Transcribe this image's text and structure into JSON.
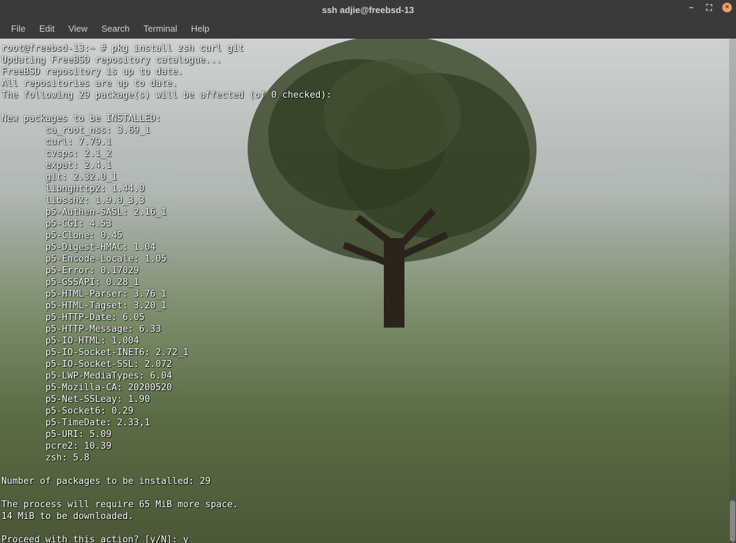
{
  "window": {
    "title": "ssh adjie@freebsd-13",
    "controls": {
      "minimize": "−",
      "maximize": "⛶",
      "close": "×"
    }
  },
  "menu": {
    "items": [
      "File",
      "Edit",
      "View",
      "Search",
      "Terminal",
      "Help"
    ]
  },
  "terminal": {
    "prompt": "root@freebsd-13:~ # ",
    "command": "pkg install zsh curl git",
    "preamble": [
      "Updating FreeBSD repository catalogue...",
      "FreeBSD repository is up to date.",
      "All repositories are up to date.",
      "The following 29 package(s) will be affected (of 0 checked):",
      "",
      "New packages to be INSTALLED:"
    ],
    "packages": [
      {
        "name": "ca_root_nss",
        "version": "3.69_1"
      },
      {
        "name": "curl",
        "version": "7.79.1"
      },
      {
        "name": "cvsps",
        "version": "2.1_2"
      },
      {
        "name": "expat",
        "version": "2.4.1"
      },
      {
        "name": "git",
        "version": "2.32.0_1"
      },
      {
        "name": "libnghttp2",
        "version": "1.44.0"
      },
      {
        "name": "libssh2",
        "version": "1.9.0_3,3"
      },
      {
        "name": "p5-Authen-SASL",
        "version": "2.16_1"
      },
      {
        "name": "p5-CGI",
        "version": "4.53"
      },
      {
        "name": "p5-Clone",
        "version": "0.45"
      },
      {
        "name": "p5-Digest-HMAC",
        "version": "1.04"
      },
      {
        "name": "p5-Encode-Locale",
        "version": "1.05"
      },
      {
        "name": "p5-Error",
        "version": "0.17029"
      },
      {
        "name": "p5-GSSAPI",
        "version": "0.28_1"
      },
      {
        "name": "p5-HTML-Parser",
        "version": "3.76_1"
      },
      {
        "name": "p5-HTML-Tagset",
        "version": "3.20_1"
      },
      {
        "name": "p5-HTTP-Date",
        "version": "6.05"
      },
      {
        "name": "p5-HTTP-Message",
        "version": "6.33"
      },
      {
        "name": "p5-IO-HTML",
        "version": "1.004"
      },
      {
        "name": "p5-IO-Socket-INET6",
        "version": "2.72_1"
      },
      {
        "name": "p5-IO-Socket-SSL",
        "version": "2.072"
      },
      {
        "name": "p5-LWP-MediaTypes",
        "version": "6.04"
      },
      {
        "name": "p5-Mozilla-CA",
        "version": "20200520"
      },
      {
        "name": "p5-Net-SSLeay",
        "version": "1.90"
      },
      {
        "name": "p5-Socket6",
        "version": "0.29"
      },
      {
        "name": "p5-TimeDate",
        "version": "2.33,1"
      },
      {
        "name": "p5-URI",
        "version": "5.09"
      },
      {
        "name": "pcre2",
        "version": "10.39"
      },
      {
        "name": "zsh",
        "version": "5.8"
      }
    ],
    "summary": [
      "",
      "Number of packages to be installed: 29",
      "",
      "The process will require 65 MiB more space.",
      "14 MiB to be downloaded.",
      "",
      "Proceed with this action? [y/N]: y"
    ]
  }
}
